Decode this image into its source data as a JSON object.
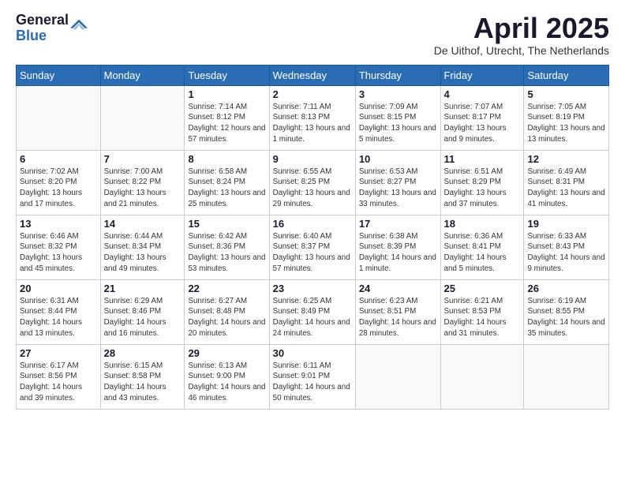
{
  "logo": {
    "general": "General",
    "blue": "Blue"
  },
  "title": "April 2025",
  "location": "De Uithof, Utrecht, The Netherlands",
  "days_of_week": [
    "Sunday",
    "Monday",
    "Tuesday",
    "Wednesday",
    "Thursday",
    "Friday",
    "Saturday"
  ],
  "weeks": [
    [
      {
        "day": "",
        "info": ""
      },
      {
        "day": "",
        "info": ""
      },
      {
        "day": "1",
        "info": "Sunrise: 7:14 AM\nSunset: 8:12 PM\nDaylight: 12 hours and 57 minutes."
      },
      {
        "day": "2",
        "info": "Sunrise: 7:11 AM\nSunset: 8:13 PM\nDaylight: 13 hours and 1 minute."
      },
      {
        "day": "3",
        "info": "Sunrise: 7:09 AM\nSunset: 8:15 PM\nDaylight: 13 hours and 5 minutes."
      },
      {
        "day": "4",
        "info": "Sunrise: 7:07 AM\nSunset: 8:17 PM\nDaylight: 13 hours and 9 minutes."
      },
      {
        "day": "5",
        "info": "Sunrise: 7:05 AM\nSunset: 8:19 PM\nDaylight: 13 hours and 13 minutes."
      }
    ],
    [
      {
        "day": "6",
        "info": "Sunrise: 7:02 AM\nSunset: 8:20 PM\nDaylight: 13 hours and 17 minutes."
      },
      {
        "day": "7",
        "info": "Sunrise: 7:00 AM\nSunset: 8:22 PM\nDaylight: 13 hours and 21 minutes."
      },
      {
        "day": "8",
        "info": "Sunrise: 6:58 AM\nSunset: 8:24 PM\nDaylight: 13 hours and 25 minutes."
      },
      {
        "day": "9",
        "info": "Sunrise: 6:55 AM\nSunset: 8:25 PM\nDaylight: 13 hours and 29 minutes."
      },
      {
        "day": "10",
        "info": "Sunrise: 6:53 AM\nSunset: 8:27 PM\nDaylight: 13 hours and 33 minutes."
      },
      {
        "day": "11",
        "info": "Sunrise: 6:51 AM\nSunset: 8:29 PM\nDaylight: 13 hours and 37 minutes."
      },
      {
        "day": "12",
        "info": "Sunrise: 6:49 AM\nSunset: 8:31 PM\nDaylight: 13 hours and 41 minutes."
      }
    ],
    [
      {
        "day": "13",
        "info": "Sunrise: 6:46 AM\nSunset: 8:32 PM\nDaylight: 13 hours and 45 minutes."
      },
      {
        "day": "14",
        "info": "Sunrise: 6:44 AM\nSunset: 8:34 PM\nDaylight: 13 hours and 49 minutes."
      },
      {
        "day": "15",
        "info": "Sunrise: 6:42 AM\nSunset: 8:36 PM\nDaylight: 13 hours and 53 minutes."
      },
      {
        "day": "16",
        "info": "Sunrise: 6:40 AM\nSunset: 8:37 PM\nDaylight: 13 hours and 57 minutes."
      },
      {
        "day": "17",
        "info": "Sunrise: 6:38 AM\nSunset: 8:39 PM\nDaylight: 14 hours and 1 minute."
      },
      {
        "day": "18",
        "info": "Sunrise: 6:36 AM\nSunset: 8:41 PM\nDaylight: 14 hours and 5 minutes."
      },
      {
        "day": "19",
        "info": "Sunrise: 6:33 AM\nSunset: 8:43 PM\nDaylight: 14 hours and 9 minutes."
      }
    ],
    [
      {
        "day": "20",
        "info": "Sunrise: 6:31 AM\nSunset: 8:44 PM\nDaylight: 14 hours and 13 minutes."
      },
      {
        "day": "21",
        "info": "Sunrise: 6:29 AM\nSunset: 8:46 PM\nDaylight: 14 hours and 16 minutes."
      },
      {
        "day": "22",
        "info": "Sunrise: 6:27 AM\nSunset: 8:48 PM\nDaylight: 14 hours and 20 minutes."
      },
      {
        "day": "23",
        "info": "Sunrise: 6:25 AM\nSunset: 8:49 PM\nDaylight: 14 hours and 24 minutes."
      },
      {
        "day": "24",
        "info": "Sunrise: 6:23 AM\nSunset: 8:51 PM\nDaylight: 14 hours and 28 minutes."
      },
      {
        "day": "25",
        "info": "Sunrise: 6:21 AM\nSunset: 8:53 PM\nDaylight: 14 hours and 31 minutes."
      },
      {
        "day": "26",
        "info": "Sunrise: 6:19 AM\nSunset: 8:55 PM\nDaylight: 14 hours and 35 minutes."
      }
    ],
    [
      {
        "day": "27",
        "info": "Sunrise: 6:17 AM\nSunset: 8:56 PM\nDaylight: 14 hours and 39 minutes."
      },
      {
        "day": "28",
        "info": "Sunrise: 6:15 AM\nSunset: 8:58 PM\nDaylight: 14 hours and 43 minutes."
      },
      {
        "day": "29",
        "info": "Sunrise: 6:13 AM\nSunset: 9:00 PM\nDaylight: 14 hours and 46 minutes."
      },
      {
        "day": "30",
        "info": "Sunrise: 6:11 AM\nSunset: 9:01 PM\nDaylight: 14 hours and 50 minutes."
      },
      {
        "day": "",
        "info": ""
      },
      {
        "day": "",
        "info": ""
      },
      {
        "day": "",
        "info": ""
      }
    ]
  ]
}
